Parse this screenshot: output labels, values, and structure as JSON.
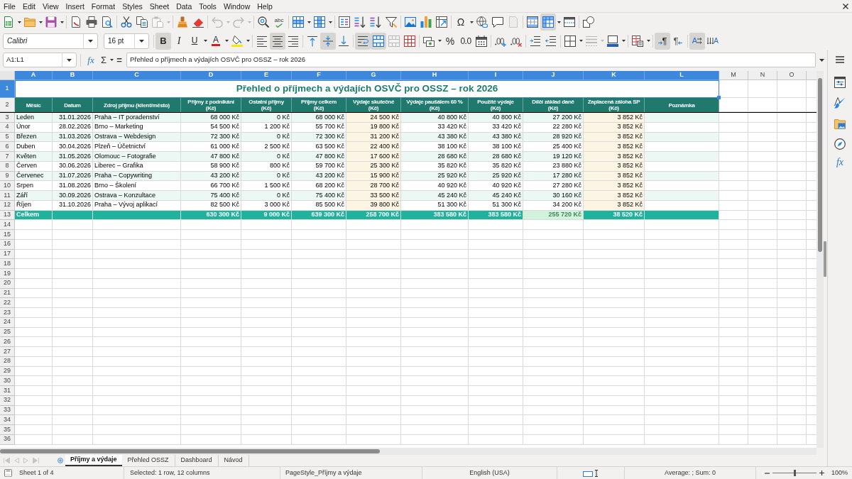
{
  "menu": [
    "File",
    "Edit",
    "View",
    "Insert",
    "Format",
    "Styles",
    "Sheet",
    "Data",
    "Tools",
    "Window",
    "Help"
  ],
  "standard_toolbar": {
    "paste": {
      "disabled": true
    },
    "undo": {
      "disabled": true
    },
    "redo": {
      "disabled": true
    },
    "spelling": {
      "label": "abc"
    },
    "special_character": {
      "label": "Ω"
    },
    "freeze_rows_columns": {
      "on": true
    }
  },
  "formatting_toolbar": {
    "font_name": "Calibri",
    "font_size": "16 pt",
    "bold": {
      "label": "B",
      "on": true
    },
    "italic": {
      "label": "I",
      "on": false
    },
    "underline": {
      "label": "U",
      "on": false
    },
    "font_color": {
      "label": "A"
    },
    "align_left": {
      "on": false
    },
    "align_center": {
      "on": true
    },
    "align_right": {
      "on": false
    },
    "align_top": {
      "on": false
    },
    "align_middle": {
      "on": true
    },
    "align_bottom": {
      "on": false
    },
    "wrap_text": {
      "on": true
    },
    "merge_and_center": {
      "on": true
    },
    "merge_cells": {
      "disabled": true
    },
    "percent": {
      "label": "%"
    },
    "standard_format": {
      "label": "0.0"
    },
    "border_style": {
      "disabled": true
    },
    "left_to_right": {
      "label": "¶",
      "on": true
    },
    "right_to_left": {
      "label": "¶",
      "on": false
    },
    "text_horizontal": {
      "label": "A",
      "on": true
    },
    "text_vertical": {
      "label": "A",
      "on": false
    }
  },
  "formula_bar": {
    "name_box": "A1:L1",
    "function_wizard": "fx",
    "sum": "Σ",
    "formula": "=",
    "content": "Přehled o příjmech a výdajích OSVČ pro OSSZ – rok 2026"
  },
  "sidebar": {
    "functions": "fx"
  },
  "sheet": {
    "columns": [
      {
        "label": "A",
        "selected": true
      },
      {
        "label": "B",
        "selected": true
      },
      {
        "label": "C",
        "selected": true
      },
      {
        "label": "D",
        "selected": true
      },
      {
        "label": "E",
        "selected": true
      },
      {
        "label": "F",
        "selected": true
      },
      {
        "label": "G",
        "selected": true
      },
      {
        "label": "H",
        "selected": true
      },
      {
        "label": "I",
        "selected": true
      },
      {
        "label": "J",
        "selected": true
      },
      {
        "label": "K",
        "selected": true
      },
      {
        "label": "L",
        "selected": true
      },
      {
        "label": "M",
        "selected": false
      },
      {
        "label": "N",
        "selected": false
      },
      {
        "label": "O",
        "selected": false
      }
    ],
    "title_row": {
      "row": "1",
      "selected": true,
      "title": "Přehled o příjmech a výdajích OSVČ pro OSSZ – rok 2026"
    },
    "header_row": {
      "row": "2",
      "selected": false,
      "cells": [
        "Měsíc",
        "Datum",
        "Zdroj příjmu (klient/město)",
        "Příjmy z podnikání\n(Kč)",
        "Ostatní příjmy\n(Kč)",
        "Příjmy celkem\n(Kč)",
        "Výdaje skutečné\n(Kč)",
        "Výdaje paušálem 60 %\n(Kč)",
        "Použité výdaje\n(Kč)",
        "Dílčí základ daně\n(Kč)",
        "Zaplacená záloha SP\n(Kč)",
        "Poznámka"
      ]
    },
    "data_rows": [
      {
        "row": "3",
        "selected": false,
        "cells": [
          "Leden",
          "31.01.2026",
          "Praha – IT poradenství",
          "68 000 Kč",
          "0 Kč",
          "68 000 Kč",
          "24 500 Kč",
          "40 800 Kč",
          "40 800 Kč",
          "27 200 Kč",
          "3 852 Kč"
        ]
      },
      {
        "row": "4",
        "selected": false,
        "cells": [
          "Únor",
          "28.02.2026",
          "Brno – Marketing",
          "54 500 Kč",
          "1 200 Kč",
          "55 700 Kč",
          "19 800 Kč",
          "33 420 Kč",
          "33 420 Kč",
          "22 280 Kč",
          "3 852 Kč"
        ]
      },
      {
        "row": "5",
        "selected": false,
        "cells": [
          "Březen",
          "31.03.2026",
          "Ostrava – Webdesign",
          "72 300 Kč",
          "0 Kč",
          "72 300 Kč",
          "31 200 Kč",
          "43 380 Kč",
          "43 380 Kč",
          "28 920 Kč",
          "3 852 Kč"
        ]
      },
      {
        "row": "6",
        "selected": false,
        "cells": [
          "Duben",
          "30.04.2026",
          "Plzeň – Účetnictví",
          "61 000 Kč",
          "2 500 Kč",
          "63 500 Kč",
          "22 400 Kč",
          "38 100 Kč",
          "38 100 Kč",
          "25 400 Kč",
          "3 852 Kč"
        ]
      },
      {
        "row": "7",
        "selected": false,
        "cells": [
          "Květen",
          "31.05.2026",
          "Olomouc – Fotografie",
          "47 800 Kč",
          "0 Kč",
          "47 800 Kč",
          "17 600 Kč",
          "28 680 Kč",
          "28 680 Kč",
          "19 120 Kč",
          "3 852 Kč"
        ]
      },
      {
        "row": "8",
        "selected": false,
        "cells": [
          "Červen",
          "30.06.2026",
          "Liberec – Grafika",
          "58 900 Kč",
          "800 Kč",
          "59 700 Kč",
          "25 300 Kč",
          "35 820 Kč",
          "35 820 Kč",
          "23 880 Kč",
          "3 852 Kč"
        ]
      },
      {
        "row": "9",
        "selected": false,
        "cells": [
          "Červenec",
          "31.07.2026",
          "Praha – Copywriting",
          "43 200 Kč",
          "0 Kč",
          "43 200 Kč",
          "15 900 Kč",
          "25 920 Kč",
          "25 920 Kč",
          "17 280 Kč",
          "3 852 Kč"
        ]
      },
      {
        "row": "10",
        "selected": false,
        "cells": [
          "Srpen",
          "31.08.2026",
          "Brno – Školení",
          "66 700 Kč",
          "1 500 Kč",
          "68 200 Kč",
          "28 700 Kč",
          "40 920 Kč",
          "40 920 Kč",
          "27 280 Kč",
          "3 852 Kč"
        ]
      },
      {
        "row": "11",
        "selected": false,
        "cells": [
          "Září",
          "30.09.2026",
          "Ostrava – Konzultace",
          "75 400 Kč",
          "0 Kč",
          "75 400 Kč",
          "33 500 Kč",
          "45 240 Kč",
          "45 240 Kč",
          "30 160 Kč",
          "3 852 Kč"
        ]
      },
      {
        "row": "12",
        "selected": false,
        "cells": [
          "Říjen",
          "31.10.2026",
          "Praha – Vývoj aplikací",
          "82 500 Kč",
          "3 000 Kč",
          "85 500 Kč",
          "39 800 Kč",
          "51 300 Kč",
          "51 300 Kč",
          "34 200 Kč",
          "3 852 Kč"
        ]
      }
    ],
    "total_row": {
      "row": "13",
      "selected": false,
      "label": "Celkem",
      "values": [
        "630 300 Kč",
        "9 000 Kč",
        "639 300 Kč",
        "258 700 Kč",
        "383 580 Kč",
        "383 580 Kč",
        "255 720 Kč",
        "38 520 Kč"
      ]
    },
    "empty_rows": [
      {
        "row": "14",
        "selected": false
      },
      {
        "row": "15",
        "selected": false
      },
      {
        "row": "16",
        "selected": false
      },
      {
        "row": "17",
        "selected": false
      },
      {
        "row": "18",
        "selected": false
      },
      {
        "row": "19",
        "selected": false
      },
      {
        "row": "20",
        "selected": false
      },
      {
        "row": "21",
        "selected": false
      },
      {
        "row": "22",
        "selected": false
      },
      {
        "row": "23",
        "selected": false
      },
      {
        "row": "24",
        "selected": false
      },
      {
        "row": "25",
        "selected": false
      },
      {
        "row": "26",
        "selected": false
      },
      {
        "row": "27",
        "selected": false
      },
      {
        "row": "28",
        "selected": false
      },
      {
        "row": "29",
        "selected": false
      },
      {
        "row": "30",
        "selected": false
      },
      {
        "row": "31",
        "selected": false
      },
      {
        "row": "32",
        "selected": false
      },
      {
        "row": "33",
        "selected": false
      },
      {
        "row": "34",
        "selected": false
      },
      {
        "row": "35",
        "selected": false
      },
      {
        "row": "36",
        "selected": false
      }
    ]
  },
  "sheet_tabs": [
    {
      "label": "Příjmy a výdaje",
      "selected": true
    },
    {
      "label": "Přehled OSSZ",
      "selected": false
    },
    {
      "label": "Dashboard",
      "selected": false
    },
    {
      "label": "Návod",
      "selected": false
    }
  ],
  "status_bar": {
    "sheet": "Sheet 1 of 4",
    "selection": "Selected: 1 row, 12 columns",
    "page_style": "PageStyle_Příjmy a výdaje",
    "language": "English (USA)",
    "summary": "Average: ; Sum: 0",
    "zoom_slider": {
      "level": 0.5
    },
    "zoom": "100%"
  }
}
